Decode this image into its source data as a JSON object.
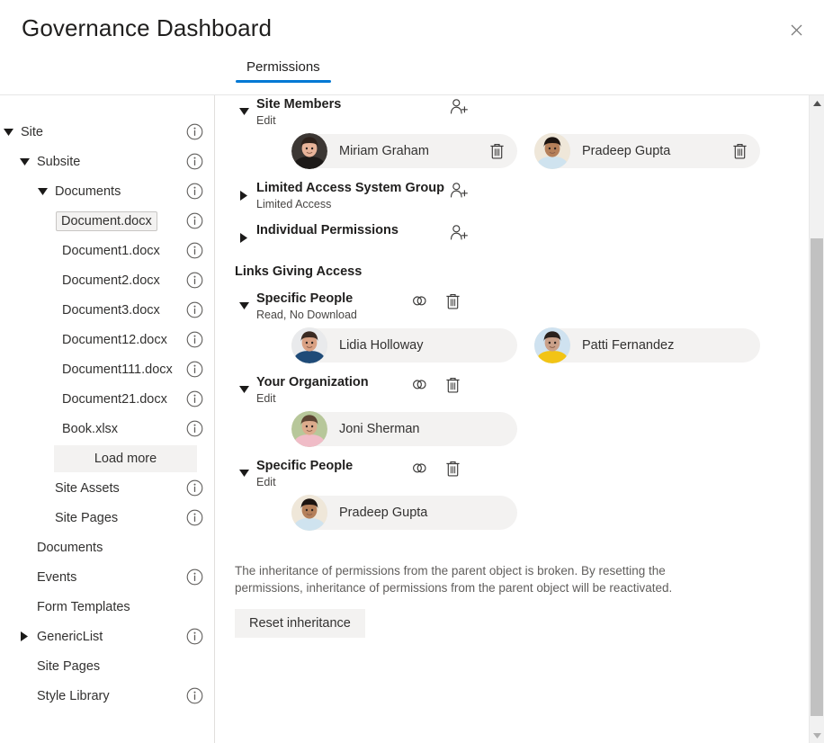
{
  "header": {
    "title": "Governance Dashboard",
    "close_icon": "close-icon",
    "close_label": "Close"
  },
  "tabs": [
    {
      "label": "Permissions",
      "active": true
    }
  ],
  "colors": {
    "accent": "#0078d4",
    "pill_bg": "#f3f2f1",
    "text": "#323130",
    "muted": "#605e5c",
    "divider": "#e1dfdd",
    "scroll_thumb": "#c1c1c1"
  },
  "sidebar": {
    "items": [
      {
        "label": "Site",
        "indent": 0,
        "chevron": "expanded",
        "info": true,
        "selected": false
      },
      {
        "label": "Subsite",
        "indent": 1,
        "chevron": "expanded",
        "info": true,
        "selected": false
      },
      {
        "label": "Documents",
        "indent": 2,
        "chevron": "expanded",
        "info": true,
        "selected": false
      },
      {
        "label": "Document.docx",
        "indent": 3,
        "chevron": "none",
        "info": true,
        "selected": true
      },
      {
        "label": "Document1.docx",
        "indent": 3,
        "chevron": "none",
        "info": true,
        "selected": false
      },
      {
        "label": "Document2.docx",
        "indent": 3,
        "chevron": "none",
        "info": true,
        "selected": false
      },
      {
        "label": "Document3.docx",
        "indent": 3,
        "chevron": "none",
        "info": true,
        "selected": false
      },
      {
        "label": "Document12.docx",
        "indent": 3,
        "chevron": "none",
        "info": true,
        "selected": false
      },
      {
        "label": "Document111.docx",
        "indent": 3,
        "chevron": "none",
        "info": true,
        "selected": false
      },
      {
        "label": "Document21.docx",
        "indent": 3,
        "chevron": "none",
        "info": true,
        "selected": false
      },
      {
        "label": "Book.xlsx",
        "indent": 3,
        "chevron": "none",
        "info": true,
        "selected": false
      },
      {
        "label": "Load more",
        "indent": 3,
        "chevron": "none",
        "info": false,
        "selected": false,
        "kind": "button"
      },
      {
        "label": "Site Assets",
        "indent": 2,
        "chevron": "none",
        "info": true,
        "selected": false
      },
      {
        "label": "Site Pages",
        "indent": 2,
        "chevron": "none",
        "info": true,
        "selected": false
      },
      {
        "label": "Documents",
        "indent": 1,
        "chevron": "none",
        "info": false,
        "selected": false
      },
      {
        "label": "Events",
        "indent": 1,
        "chevron": "none",
        "info": true,
        "selected": false
      },
      {
        "label": "Form Templates",
        "indent": 1,
        "chevron": "none",
        "info": false,
        "selected": false
      },
      {
        "label": "GenericList",
        "indent": 1,
        "chevron": "collapsed",
        "info": true,
        "selected": false
      },
      {
        "label": "Site Pages",
        "indent": 1,
        "chevron": "none",
        "info": false,
        "selected": false
      },
      {
        "label": "Style Library",
        "indent": 1,
        "chevron": "none",
        "info": true,
        "selected": false
      }
    ]
  },
  "permissions": {
    "groups": [
      {
        "title": "Site Members",
        "subtitle": "Edit",
        "chevron": "expanded",
        "actions": [
          "add-person-icon"
        ],
        "members": [
          {
            "name": "Miriam Graham",
            "avatar": "miriam",
            "deletable": true
          },
          {
            "name": "Pradeep Gupta",
            "avatar": "pradeep",
            "deletable": true
          }
        ]
      },
      {
        "title": "Limited Access System Group",
        "subtitle": "Limited Access",
        "chevron": "collapsed",
        "actions": [
          "add-person-icon"
        ],
        "members": []
      },
      {
        "title": "Individual Permissions",
        "subtitle": "",
        "chevron": "collapsed",
        "actions": [
          "add-person-icon"
        ],
        "members": []
      }
    ],
    "links_section_title": "Links Giving Access",
    "links": [
      {
        "title": "Specific People",
        "subtitle": "Read, No Download",
        "chevron": "expanded",
        "actions": [
          "link-icon",
          "delete-icon"
        ],
        "members": [
          {
            "name": "Lidia Holloway",
            "avatar": "lidia",
            "deletable": false
          },
          {
            "name": "Patti Fernandez",
            "avatar": "patti",
            "deletable": false
          }
        ]
      },
      {
        "title": "Your Organization",
        "subtitle": "Edit",
        "chevron": "expanded",
        "actions": [
          "link-icon",
          "delete-icon"
        ],
        "members": [
          {
            "name": "Joni Sherman",
            "avatar": "joni",
            "deletable": false
          }
        ]
      },
      {
        "title": "Specific People",
        "subtitle": "Edit",
        "chevron": "expanded",
        "actions": [
          "link-icon",
          "delete-icon"
        ],
        "members": [
          {
            "name": "Pradeep Gupta",
            "avatar": "pradeep",
            "deletable": false
          }
        ]
      }
    ],
    "inheritance_note": "The inheritance of permissions from the parent object is broken. By resetting the permissions, inheritance of permissions from the parent object will be reactivated.",
    "reset_label": "Reset inheritance"
  },
  "scrollbar": {
    "up_icon": "scroll-up-arrow-icon",
    "down_icon": "scroll-down-arrow-icon"
  }
}
